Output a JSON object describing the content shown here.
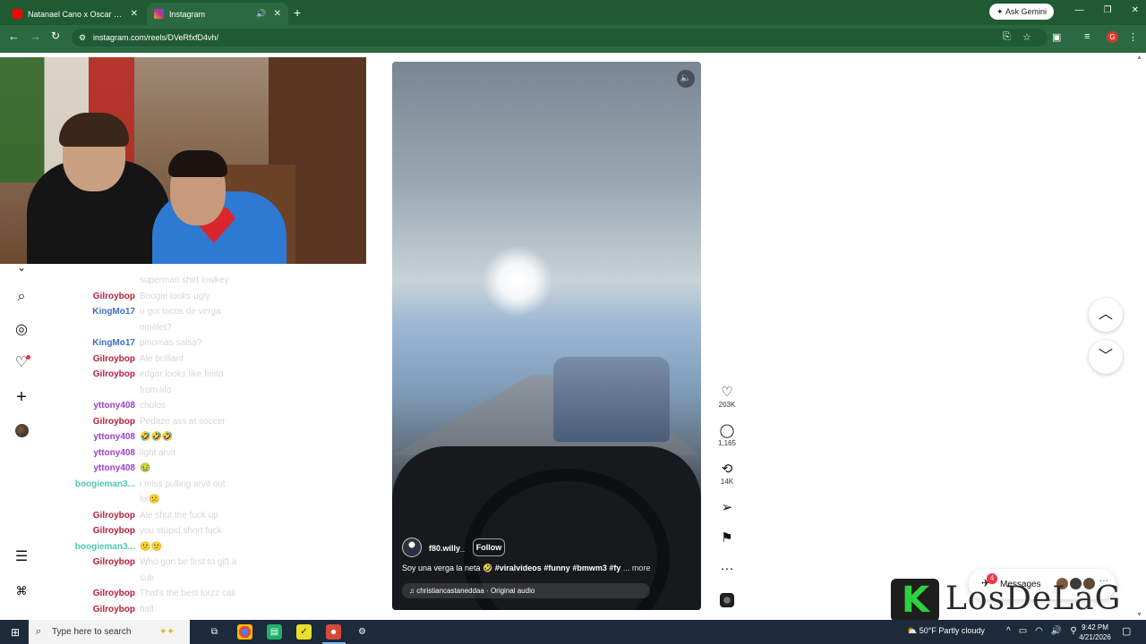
{
  "browser": {
    "tabs": [
      {
        "title": "Natanael Cano x Oscar Maydon",
        "favicon_color": "#ff0000"
      },
      {
        "title": "Instagram",
        "favicon_color": "#c13584",
        "audio_icon": "speaker-icon"
      }
    ],
    "ask_gemini": "Ask Gemini",
    "url": "instagram.com/reels/DVeRfxfD4vh/"
  },
  "chat": [
    {
      "user": "",
      "msg": "superman shirt lowkey",
      "color": "#b5203a"
    },
    {
      "user": "Gilroybop",
      "msg": "Boogie looks ugly",
      "color": "#b5203a"
    },
    {
      "user": "KingMo17",
      "msg": "u got tacos de verga",
      "color": "#3a6fc9"
    },
    {
      "user": "",
      "msg": "omelet?",
      "color": "#3a6fc9"
    },
    {
      "user": "KingMo17",
      "msg": "pinomas salsa?",
      "color": "#3a6fc9"
    },
    {
      "user": "Gilroybop",
      "msg": "Ale brilliant",
      "color": "#b5203a"
    },
    {
      "user": "Gilroybop",
      "msg": "edgar looks like finito",
      "color": "#b5203a"
    },
    {
      "user": "",
      "msg": "from lifo",
      "color": "#b5203a"
    },
    {
      "user": "yttony408",
      "msg": "chulos",
      "color": "#9b3fd1"
    },
    {
      "user": "Gilroybop",
      "msg": "Pedazo ass at soccer",
      "color": "#b5203a"
    },
    {
      "user": "yttony408",
      "msg": "🤣🤣🤣",
      "color": "#9b3fd1",
      "emoji": [
        "#f2b21a",
        "#f2b21a",
        "#f2b21a"
      ]
    },
    {
      "user": "yttony408",
      "msg": "light arvit",
      "color": "#9b3fd1"
    },
    {
      "user": "yttony408",
      "msg": "🤢",
      "color": "#9b3fd1",
      "emoji": [
        "#4cc94c"
      ]
    },
    {
      "user": "boogieman3...",
      "msg": "i miss pulling arvit out",
      "color": "#4fc9b2"
    },
    {
      "user": "",
      "msg": "lol😕",
      "color": "#4fc9b2",
      "emoji": [
        "#f2b21a"
      ]
    },
    {
      "user": "Gilroybop",
      "msg": "Ale shut the fuck up",
      "color": "#b5203a"
    },
    {
      "user": "Gilroybop",
      "msg": "you stupid short fuck",
      "color": "#b5203a"
    },
    {
      "user": "boogieman3...",
      "msg": "😕😕",
      "color": "#4fc9b2",
      "emoji": [
        "#f2b21a",
        "#f2b21a"
      ]
    },
    {
      "user": "Gilroybop",
      "msg": "Who gon be first to gift a",
      "color": "#b5203a"
    },
    {
      "user": "",
      "msg": "sub",
      "color": "#b5203a"
    },
    {
      "user": "Gilroybop",
      "msg": "That's the best lorzz call",
      "color": "#b5203a"
    },
    {
      "user": "Gilroybop",
      "msg": "ball",
      "color": "#b5203a"
    }
  ],
  "reel": {
    "username": "f80.willy_",
    "follow": "Follow",
    "caption_text": "Soy una verga la neta 🤣 ",
    "caption_tags": "#viralvideos #funny #bmwm3 #fy",
    "caption_more": " ... more",
    "audio": "♫ christiancastaneddaa · Original audio"
  },
  "actions": {
    "likes": "203K",
    "comments": "1,165",
    "reposts": "14K"
  },
  "messages": {
    "label": "Messages",
    "badge": "4",
    "more": "···"
  },
  "watermark": {
    "letter": "K",
    "text": "LosDeLaG"
  },
  "taskbar": {
    "search_placeholder": "Type here to search",
    "weather": "50°F  Partly cloudy",
    "time": "9:42 PM",
    "date": "4/21/2026"
  }
}
